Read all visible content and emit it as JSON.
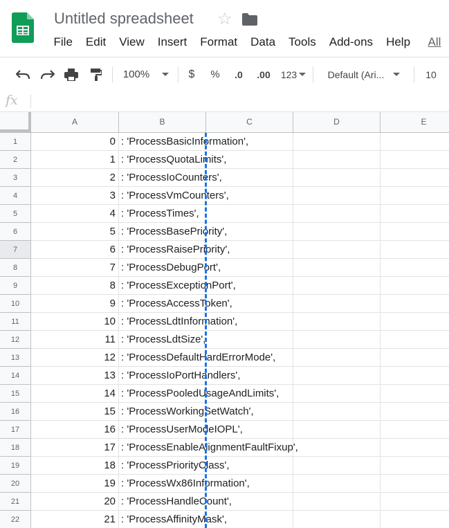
{
  "app": {
    "title": "Untitled spreadsheet",
    "icons": {
      "logo": "sheets-logo",
      "star": "star-icon",
      "folder": "folder-icon"
    }
  },
  "menu": [
    "File",
    "Edit",
    "View",
    "Insert",
    "Format",
    "Data",
    "Tools",
    "Add-ons",
    "Help",
    "All"
  ],
  "toolbar": {
    "zoom": "100%",
    "currency": "$",
    "percent": "%",
    "dec_less": ".0",
    "dec_more": ".00",
    "more_formats": "123",
    "font": "Default (Ari...",
    "font_size": "10"
  },
  "formula_bar": {
    "fx": "fx",
    "value": ""
  },
  "columns": [
    "A",
    "B",
    "C",
    "D",
    "E"
  ],
  "colors": {
    "accent": "#1a73e8",
    "brand": "#0f9d58"
  },
  "rows": [
    {
      "num": "1",
      "a": "0",
      "b": ": 'ProcessBasicInformation',"
    },
    {
      "num": "2",
      "a": "1",
      "b": ": 'ProcessQuotaLimits',"
    },
    {
      "num": "3",
      "a": "2",
      "b": ": 'ProcessIoCounters',"
    },
    {
      "num": "4",
      "a": "3",
      "b": ": 'ProcessVmCounters',"
    },
    {
      "num": "5",
      "a": "4",
      "b": ": 'ProcessTimes',"
    },
    {
      "num": "6",
      "a": "5",
      "b": ": 'ProcessBasePriority',"
    },
    {
      "num": "7",
      "a": "6",
      "b": ": 'ProcessRaisePriority',"
    },
    {
      "num": "8",
      "a": "7",
      "b": ": 'ProcessDebugPort',"
    },
    {
      "num": "9",
      "a": "8",
      "b": ": 'ProcessExceptionPort',"
    },
    {
      "num": "10",
      "a": "9",
      "b": ": 'ProcessAccessToken',"
    },
    {
      "num": "11",
      "a": "10",
      "b": ": 'ProcessLdtInformation',"
    },
    {
      "num": "12",
      "a": "11",
      "b": ": 'ProcessLdtSize',"
    },
    {
      "num": "13",
      "a": "12",
      "b": ": 'ProcessDefaultHardErrorMode',"
    },
    {
      "num": "14",
      "a": "13",
      "b": ": 'ProcessIoPortHandlers',"
    },
    {
      "num": "15",
      "a": "14",
      "b": ": 'ProcessPooledUsageAndLimits',"
    },
    {
      "num": "16",
      "a": "15",
      "b": ": 'ProcessWorkingSetWatch',"
    },
    {
      "num": "17",
      "a": "16",
      "b": ": 'ProcessUserModeIOPL',"
    },
    {
      "num": "18",
      "a": "17",
      "b": ": 'ProcessEnableAlignmentFaultFixup',"
    },
    {
      "num": "19",
      "a": "18",
      "b": ": 'ProcessPriorityClass',"
    },
    {
      "num": "20",
      "a": "19",
      "b": ": 'ProcessWx86Information',"
    },
    {
      "num": "21",
      "a": "20",
      "b": ": 'ProcessHandleCount',"
    },
    {
      "num": "22",
      "a": "21",
      "b": ": 'ProcessAffinityMask',"
    }
  ]
}
